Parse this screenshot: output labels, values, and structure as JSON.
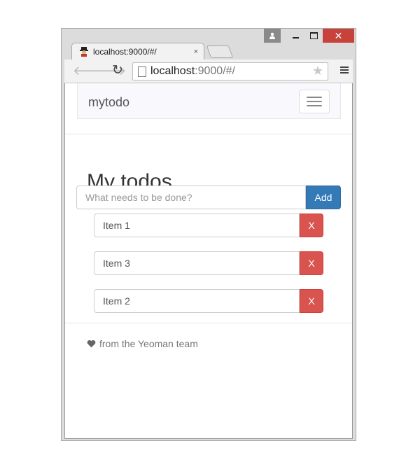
{
  "browser": {
    "tab_title": "localhost:9000/#/",
    "tab_close": "×",
    "url_host": "localhost",
    "url_path": ":9000/#/",
    "close_glyph": "✕"
  },
  "app": {
    "brand": "mytodo",
    "heading": "My todos",
    "add_placeholder": "What needs to be done?",
    "add_label": "Add",
    "todos": [
      {
        "text": "Item 1",
        "delete_label": "X"
      },
      {
        "text": "Item 3",
        "delete_label": "X"
      },
      {
        "text": "Item 2",
        "delete_label": "X"
      }
    ],
    "footer_text": "from the Yeoman team"
  },
  "colors": {
    "primary": "#337ab7",
    "danger": "#d9534f",
    "close_button": "#c7423a"
  },
  "icons": {
    "heart": "heart-icon",
    "back": "back-arrow-icon",
    "forward": "forward-arrow-icon",
    "reload": "reload-icon",
    "star": "bookmark-star-icon",
    "menu": "chrome-menu-icon"
  }
}
